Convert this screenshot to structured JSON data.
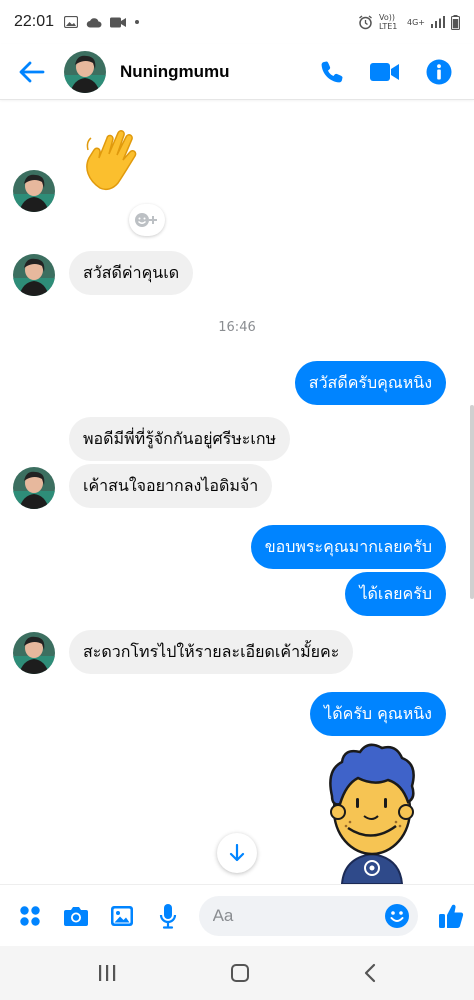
{
  "status_bar": {
    "time": "22:01",
    "network_label": "Vo)) LTE1",
    "net_type": "4G+",
    "colors": {
      "icon": "#555555"
    }
  },
  "header": {
    "contact_name": "Nuningmumu",
    "icons": [
      "back-arrow-icon",
      "phone-icon",
      "video-camera-icon",
      "info-icon"
    ],
    "accent_color": "#0084ff"
  },
  "conversation": {
    "timestamp": "16:46",
    "messages": [
      {
        "from": "them",
        "type": "emoji",
        "text": "👋"
      },
      {
        "from": "them",
        "text": "สวัสดีค่าคุนเด"
      },
      {
        "from": "me",
        "text": "สวัสดีครับคุณหนิง"
      },
      {
        "from": "them",
        "text": "พอดีมีพี่ที่รู้จักกันอยู่ศรีษะเกษ"
      },
      {
        "from": "them",
        "text": "เค้าสนใจอยากลงไอดิมจ้า"
      },
      {
        "from": "me",
        "text": "ขอบพระคุณมากเลยครับ"
      },
      {
        "from": "me",
        "text": "ได้เลยครับ"
      },
      {
        "from": "them",
        "text": "สะดวกโทรไปให้รายละเอียดเค้ามั้ยคะ"
      },
      {
        "from": "me",
        "text": "ได้ครับ คุณหนิง"
      },
      {
        "from": "me",
        "type": "sticker",
        "sticker": "boy-sticker"
      }
    ]
  },
  "composer": {
    "placeholder": "Aa",
    "value": "",
    "icons": [
      "apps-icon",
      "camera-icon",
      "gallery-icon",
      "microphone-icon",
      "emoji-icon",
      "thumbs-up-icon"
    ]
  },
  "nav_bar": {
    "icons": [
      "recent-apps-icon",
      "home-icon",
      "back-icon"
    ]
  }
}
